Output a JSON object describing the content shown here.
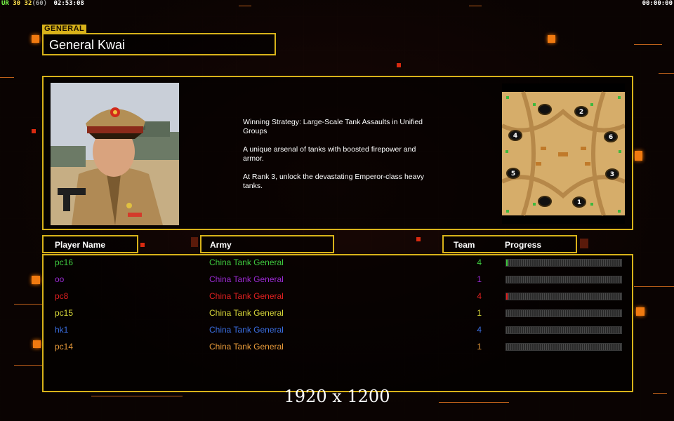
{
  "hud": {
    "stat_a": "UR",
    "stat_b": "30",
    "stat_c": "32",
    "stat_d": "(60)",
    "game_time": "02:53:08",
    "timer": "00:00:00"
  },
  "general": {
    "tag": "GENERAL",
    "name": "General Kwai",
    "description": [
      "Winning Strategy: Large-Scale Tank Assaults in Unified\n Groups",
      "A unique arsenal of tanks with boosted firepower and\n armor.",
      "At Rank 3, unlock the devastating Emperor-class heavy\n tanks."
    ]
  },
  "map": {
    "start_positions": [
      "2",
      "4",
      "6",
      "5",
      "3",
      "1"
    ]
  },
  "table": {
    "headers": {
      "player_name": "Player Name",
      "army": "Army",
      "team": "Team",
      "progress": "Progress"
    },
    "rows": [
      {
        "player": "pc16",
        "army": "China Tank General",
        "team": "4",
        "color": "#3ec83e",
        "progress": 0.01
      },
      {
        "player": "oo",
        "army": "China Tank General",
        "team": "1",
        "color": "#9a2ad0",
        "progress": 0.0
      },
      {
        "player": "pc8",
        "army": "China Tank General",
        "team": "4",
        "color": "#e02020",
        "progress": 0.01
      },
      {
        "player": "pc15",
        "army": "China Tank General",
        "team": "1",
        "color": "#d8d83a",
        "progress": 0.0
      },
      {
        "player": "hk1",
        "army": "China Tank General",
        "team": "4",
        "color": "#3a6ee0",
        "progress": 0.0
      },
      {
        "player": "pc14",
        "army": "China Tank General",
        "team": "1",
        "color": "#e89a3a",
        "progress": 0.0
      }
    ]
  },
  "footer": {
    "resolution": "1920 x 1200"
  },
  "colors": {
    "frame_gold": "#d8b21a",
    "accent_orange": "#f07a10"
  }
}
